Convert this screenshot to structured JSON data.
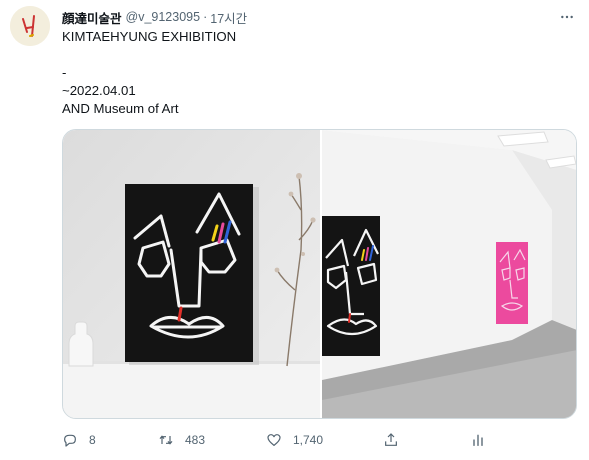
{
  "tweet": {
    "display_name": "顔達미술관",
    "handle": "@v_9123095",
    "separator": "·",
    "time": "17시간",
    "lines": {
      "line1": "KIMTAEHYUNG EXHIBITION",
      "line2": "-",
      "line3": "~2022.04.01",
      "line4": "AND Museum of Art"
    }
  },
  "actions": {
    "reply_count": "8",
    "retweet_count": "483",
    "like_count": "1,740"
  },
  "icons": {
    "more": "more-horizontal-icon",
    "reply": "reply-icon",
    "retweet": "retweet-icon",
    "like": "heart-icon",
    "share": "share-icon",
    "analytics": "analytics-icon"
  },
  "colors": {
    "text": "#0f1419",
    "muted": "#536471",
    "border": "#cfd9de",
    "artwork_black": "#141414",
    "artwork_pink": "#ec4a9e"
  }
}
